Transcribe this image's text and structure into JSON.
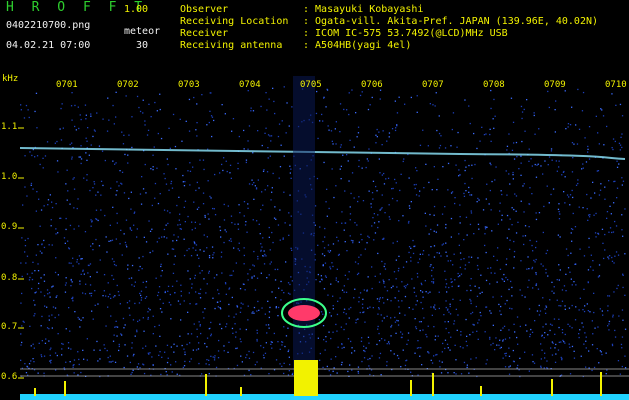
{
  "header": {
    "title": "H R O F F T",
    "version": "1.00",
    "filename": "0402210700.png",
    "datetime": "04.02.21 07:00",
    "meteor_label": "meteor",
    "meteor_count": "30"
  },
  "info": [
    {
      "key": "Observer",
      "value": ": Masayuki Kobayashi"
    },
    {
      "key": "Receiving Location",
      "value": ": Ogata-vill. Akita-Pref. JAPAN (139.96E, 40.02N)"
    },
    {
      "key": "Receiver",
      "value": ": ICOM IC-575 53.7492(@LCD)MHz USB"
    },
    {
      "key": "Receiving antenna",
      "value": ": A504HB(yagi 4el)"
    }
  ],
  "spectrogram": {
    "y_unit": "kHz",
    "y_ticks": [
      "1.1",
      "1.0",
      "0.9",
      "0.8",
      "0.7",
      "0.6"
    ],
    "x_ticks": [
      "0701",
      "0702",
      "0703",
      "0704",
      "0705",
      "0706",
      "0707",
      "0708",
      "0709",
      "0710"
    ],
    "colors": {
      "background": "#000000",
      "noise_dark": "#0a1a5a",
      "noise_light": "#3a6cff",
      "trace": "#8fe8ff",
      "meteor": "#ff3a6a",
      "counter": "#f2f200",
      "baseline": "#21d3ff"
    }
  }
}
